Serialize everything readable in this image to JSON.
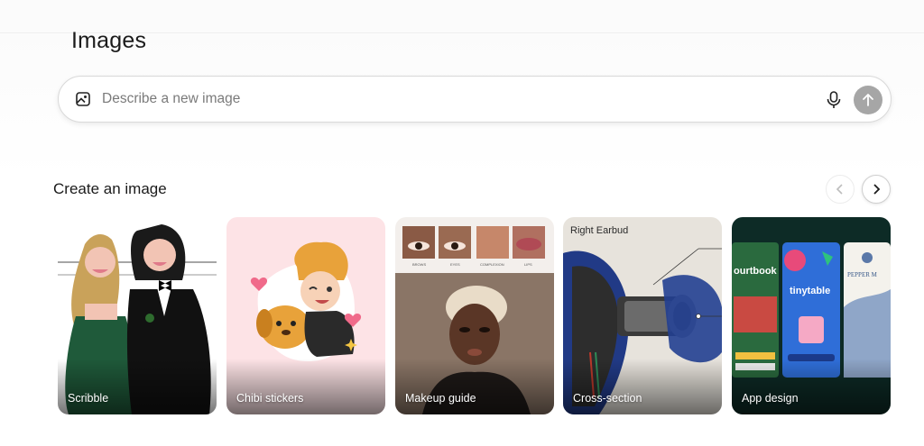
{
  "page": {
    "title": "Images"
  },
  "search": {
    "placeholder": "Describe a new image",
    "image_icon": "image-icon",
    "mic_icon": "microphone-icon",
    "send_icon": "arrow-up-icon"
  },
  "section": {
    "title": "Create an image",
    "prev_icon": "chevron-left-icon",
    "next_icon": "chevron-right-icon"
  },
  "cards": [
    {
      "label": "Scribble"
    },
    {
      "label": "Chibi stickers"
    },
    {
      "label": "Makeup guide",
      "swatch_labels": [
        "BROWS",
        "EYES",
        "COMPLEXION",
        "LIPS"
      ]
    },
    {
      "label": "Cross-section",
      "title": "Right Earbud"
    },
    {
      "label": "App design",
      "app_names": [
        "ourtbook",
        "tinytable",
        "PEPPER M"
      ]
    }
  ],
  "colors": {
    "send_button": "#a6a6a6",
    "text": "#1b1b1b"
  }
}
